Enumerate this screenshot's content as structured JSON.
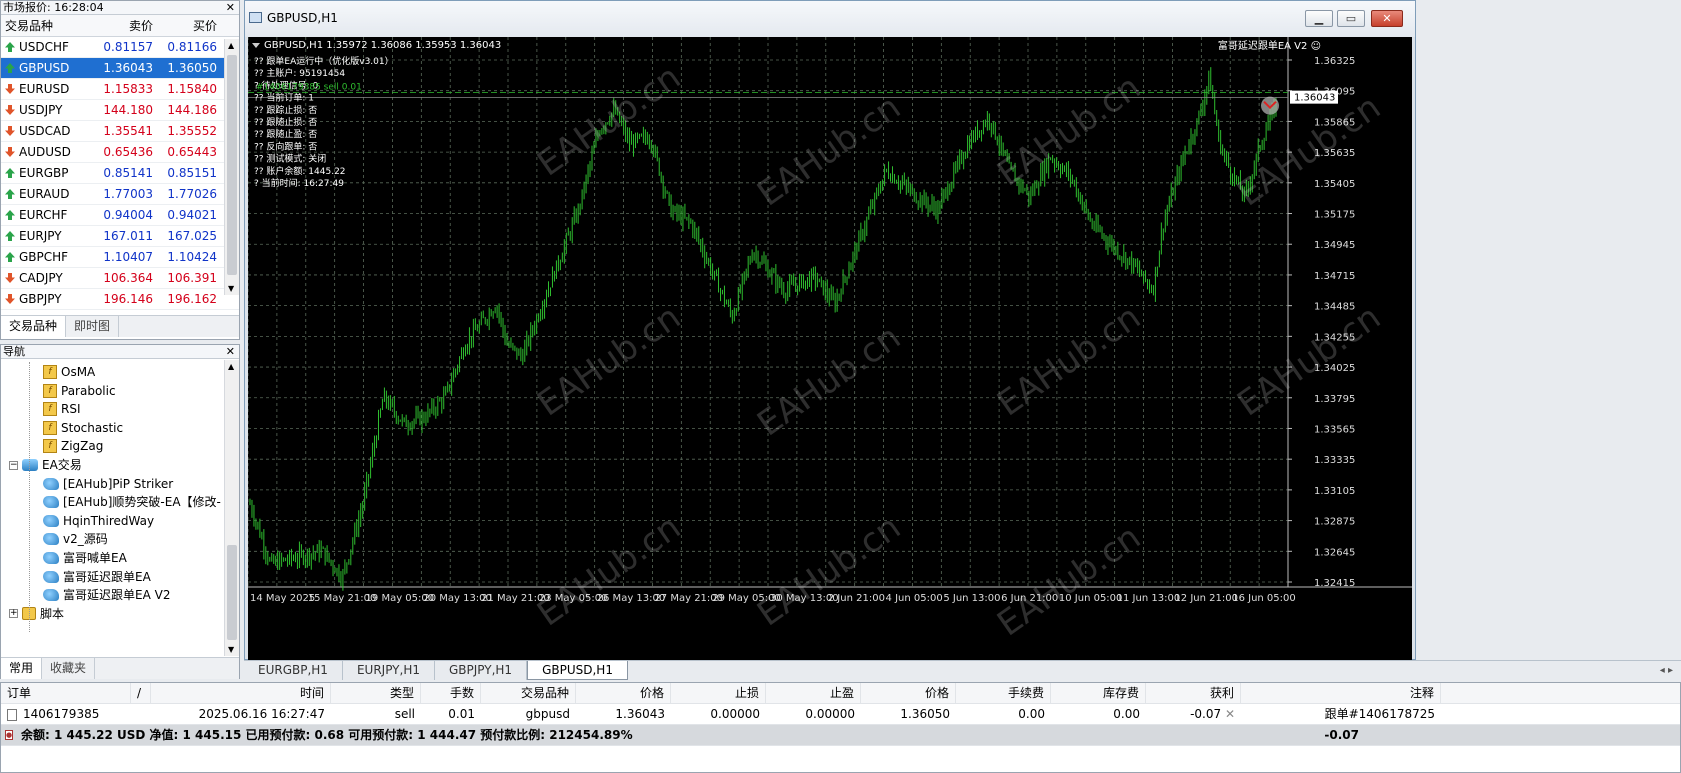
{
  "market_watch": {
    "title": "市场报价: 16:28:04",
    "col_symbol": "交易品种",
    "col_bid": "卖价",
    "col_ask": "买价",
    "rows": [
      {
        "symbol": "USDCHF",
        "bid": "0.81157",
        "ask": "0.81166",
        "dir": "up",
        "color": "blue"
      },
      {
        "symbol": "GBPUSD",
        "bid": "1.36043",
        "ask": "1.36050",
        "dir": "up",
        "color": "blue",
        "selected": true
      },
      {
        "symbol": "EURUSD",
        "bid": "1.15833",
        "ask": "1.15840",
        "dir": "dn",
        "color": "red"
      },
      {
        "symbol": "USDJPY",
        "bid": "144.180",
        "ask": "144.186",
        "dir": "dn",
        "color": "red"
      },
      {
        "symbol": "USDCAD",
        "bid": "1.35541",
        "ask": "1.35552",
        "dir": "dn",
        "color": "red"
      },
      {
        "symbol": "AUDUSD",
        "bid": "0.65436",
        "ask": "0.65443",
        "dir": "dn",
        "color": "red"
      },
      {
        "symbol": "EURGBP",
        "bid": "0.85141",
        "ask": "0.85151",
        "dir": "up",
        "color": "blue"
      },
      {
        "symbol": "EURAUD",
        "bid": "1.77003",
        "ask": "1.77026",
        "dir": "up",
        "color": "blue"
      },
      {
        "symbol": "EURCHF",
        "bid": "0.94004",
        "ask": "0.94021",
        "dir": "up",
        "color": "blue"
      },
      {
        "symbol": "EURJPY",
        "bid": "167.011",
        "ask": "167.025",
        "dir": "up",
        "color": "blue"
      },
      {
        "symbol": "GBPCHF",
        "bid": "1.10407",
        "ask": "1.10424",
        "dir": "up",
        "color": "blue"
      },
      {
        "symbol": "CADJPY",
        "bid": "106.364",
        "ask": "106.391",
        "dir": "dn",
        "color": "red"
      },
      {
        "symbol": "GBPJPY",
        "bid": "196.146",
        "ask": "196.162",
        "dir": "dn",
        "color": "red"
      }
    ],
    "tabs": [
      "交易品种",
      "即时图"
    ]
  },
  "navigator": {
    "title": "导航",
    "items": [
      {
        "label": "OsMA",
        "icon": "indicator-icon",
        "level": 2
      },
      {
        "label": "Parabolic",
        "icon": "indicator-icon",
        "level": 2
      },
      {
        "label": "RSI",
        "icon": "indicator-icon",
        "level": 2
      },
      {
        "label": "Stochastic",
        "icon": "indicator-icon",
        "level": 2
      },
      {
        "label": "ZigZag",
        "icon": "indicator-icon",
        "level": 2
      },
      {
        "label": "EA交易",
        "icon": "ea-folder-icon",
        "level": 1,
        "expander": "−"
      },
      {
        "label": "[EAHub]PiP Striker",
        "icon": "ea-icon",
        "level": 2
      },
      {
        "label": "[EAHub]顺势突破-EA【修改-",
        "icon": "ea-icon",
        "level": 2
      },
      {
        "label": "HqinThiredWay",
        "icon": "ea-icon",
        "level": 2
      },
      {
        "label": "v2_源码",
        "icon": "ea-icon",
        "level": 2
      },
      {
        "label": "富哥喊单EA",
        "icon": "ea-icon",
        "level": 2
      },
      {
        "label": "富哥延迟跟单EA",
        "icon": "ea-icon",
        "level": 2
      },
      {
        "label": "富哥延迟跟单EA V2",
        "icon": "ea-icon",
        "level": 2
      },
      {
        "label": "脚本",
        "icon": "script-icon",
        "level": 1,
        "expander": "+"
      }
    ],
    "tabs": [
      "常用",
      "收藏夹"
    ]
  },
  "chart_window": {
    "title": "GBPUSD,H1",
    "header_line": "GBPUSD,H1  1.35972 1.36086 1.35953 1.36043",
    "ea_label": "富哥延迟跟单EA V2 ☺",
    "order_line_label": "#1406179385 sell 0.01",
    "info_lines": [
      "?? 跟单EA运行中（优化版v3.01）",
      "?? 主账户: 95191454",
      "? 待处理信号: 0",
      "?? 当前订单: 1",
      "?? 跟踪止损: 否",
      "?? 跟随止损: 否",
      "?? 跟随止盈: 否",
      "?? 反向跟单: 否",
      "?? 测试模式: 关闭",
      "?? 账户余额: 1445.22",
      "? 当前时间: 16:27:49"
    ],
    "price_current": "1.36043",
    "y_ticks": [
      "1.36325",
      "1.36095",
      "1.35865",
      "1.35635",
      "1.35405",
      "1.35175",
      "1.34945",
      "1.34715",
      "1.34485",
      "1.34255",
      "1.34025",
      "1.33795",
      "1.33565",
      "1.33335",
      "1.33105",
      "1.32875",
      "1.32645",
      "1.32415"
    ],
    "x_ticks": [
      "14 May 2025",
      "15 May 21:00",
      "19 May 05:00",
      "20 May 13:00",
      "21 May 21:00",
      "23 May 05:00",
      "26 May 13:00",
      "27 May 21:00",
      "29 May 05:00",
      "30 May 13:00",
      "2 Jun 21:00",
      "4 Jun 05:00",
      "5 Jun 13:00",
      "6 Jun 21:00",
      "10 Jun 05:00",
      "11 Jun 13:00",
      "12 Jun 21:00",
      "16 Jun 05:00"
    ],
    "watermark": "EAHub.cn",
    "colors": {
      "bg": "#000000",
      "bars": "#2fbe2f",
      "grid": "#5a6a5a",
      "order": "#2fbe2f"
    }
  },
  "chart_tabs": [
    {
      "label": "EURGBP,H1",
      "active": false
    },
    {
      "label": "EURJPY,H1",
      "active": false
    },
    {
      "label": "GBPJPY,H1",
      "active": false
    },
    {
      "label": "GBPUSD,H1",
      "active": true
    }
  ],
  "terminal": {
    "headers": [
      "订单",
      "/",
      "时间",
      "类型",
      "手数",
      "交易品种",
      "价格",
      "止损",
      "止盈",
      "价格",
      "手续费",
      "库存费",
      "获利",
      "注释"
    ],
    "orders": [
      {
        "ticket": "1406179385",
        "time": "2025.06.16 16:27:47",
        "type": "sell",
        "lots": "0.01",
        "symbol": "gbpusd",
        "open_price": "1.36043",
        "sl": "0.00000",
        "tp": "0.00000",
        "price": "1.36050",
        "commission": "0.00",
        "swap": "0.00",
        "profit": "-0.07",
        "comment": "跟单#1406178725"
      }
    ],
    "summary": "余额: 1 445.22 USD  净值: 1 445.15  已用预付款: 0.68  可用预付款: 1 444.47  预付款比例: 212454.89%",
    "summary_profit": "-0.07"
  }
}
